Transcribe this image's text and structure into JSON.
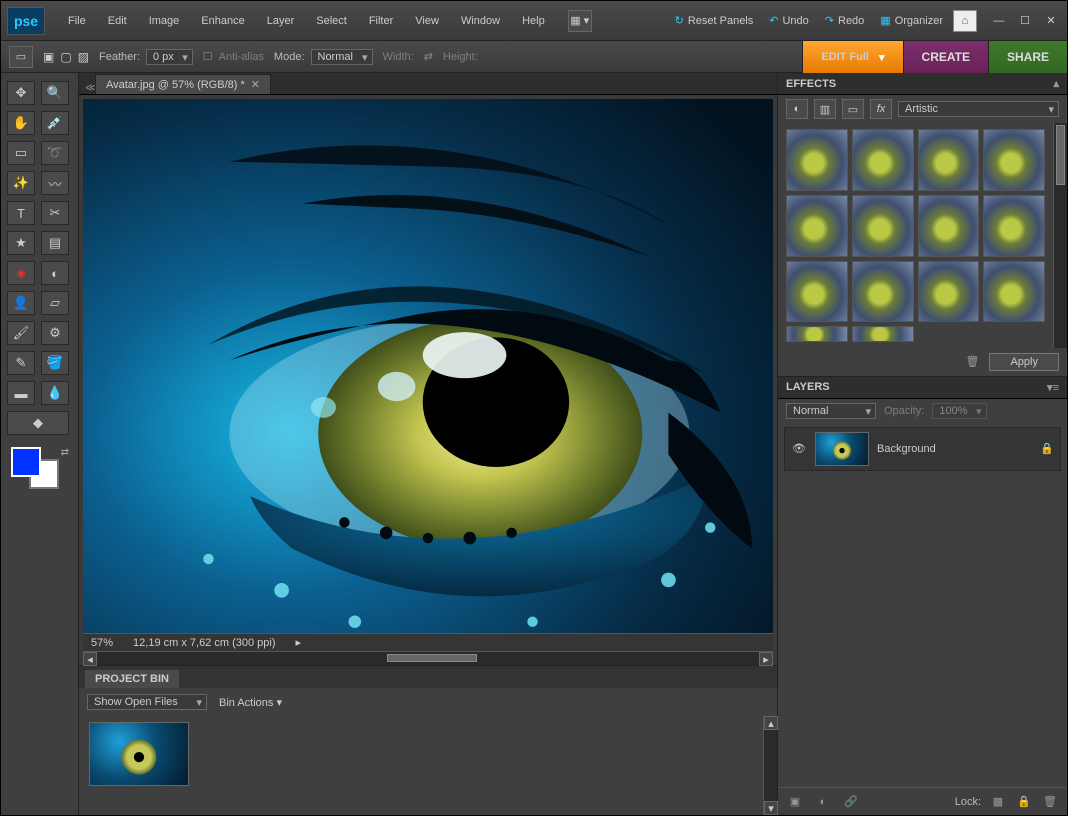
{
  "app": {
    "logo": "pse"
  },
  "menu": {
    "items": [
      "File",
      "Edit",
      "Image",
      "Enhance",
      "Layer",
      "Select",
      "Filter",
      "View",
      "Window",
      "Help"
    ]
  },
  "topbar": {
    "reset": "Reset Panels",
    "undo": "Undo",
    "redo": "Redo",
    "organizer": "Organizer"
  },
  "options": {
    "feather_label": "Feather:",
    "feather": "0 px",
    "antialias": "Anti-alias",
    "mode_label": "Mode:",
    "mode": "Normal",
    "width_label": "Width:",
    "height_label": "Height:"
  },
  "tabs": {
    "edit": "EDIT Full",
    "create": "CREATE",
    "share": "SHARE"
  },
  "document": {
    "tab": "Avatar.jpg @ 57% (RGB/8) *",
    "zoom": "57%",
    "dims": "12,19 cm x 7,62 cm (300 ppi)"
  },
  "projectbin": {
    "title": "PROJECT BIN",
    "show": "Show Open Files",
    "actions": "Bin Actions"
  },
  "effects": {
    "title": "EFFECTS",
    "category": "Artistic",
    "apply": "Apply",
    "thumb_count": 14
  },
  "layers": {
    "title": "LAYERS",
    "blend": "Normal",
    "opacity_label": "Opacity:",
    "opacity": "100%",
    "items": [
      {
        "name": "Background",
        "locked": true,
        "visible": true
      }
    ],
    "lock_label": "Lock:"
  },
  "colors": {
    "fg": "#0033ff",
    "bg": "#ffffff"
  },
  "tools": [
    "move",
    "zoom",
    "hand",
    "eyedropper",
    "marquee",
    "lasso",
    "wand",
    "quick-select",
    "type",
    "crop",
    "cookie-cutter",
    "recompose",
    "redeye",
    "healing",
    "clone",
    "eraser",
    "brush",
    "pencil",
    "bucket",
    "gradient",
    "shape",
    "blur",
    "sponge"
  ]
}
